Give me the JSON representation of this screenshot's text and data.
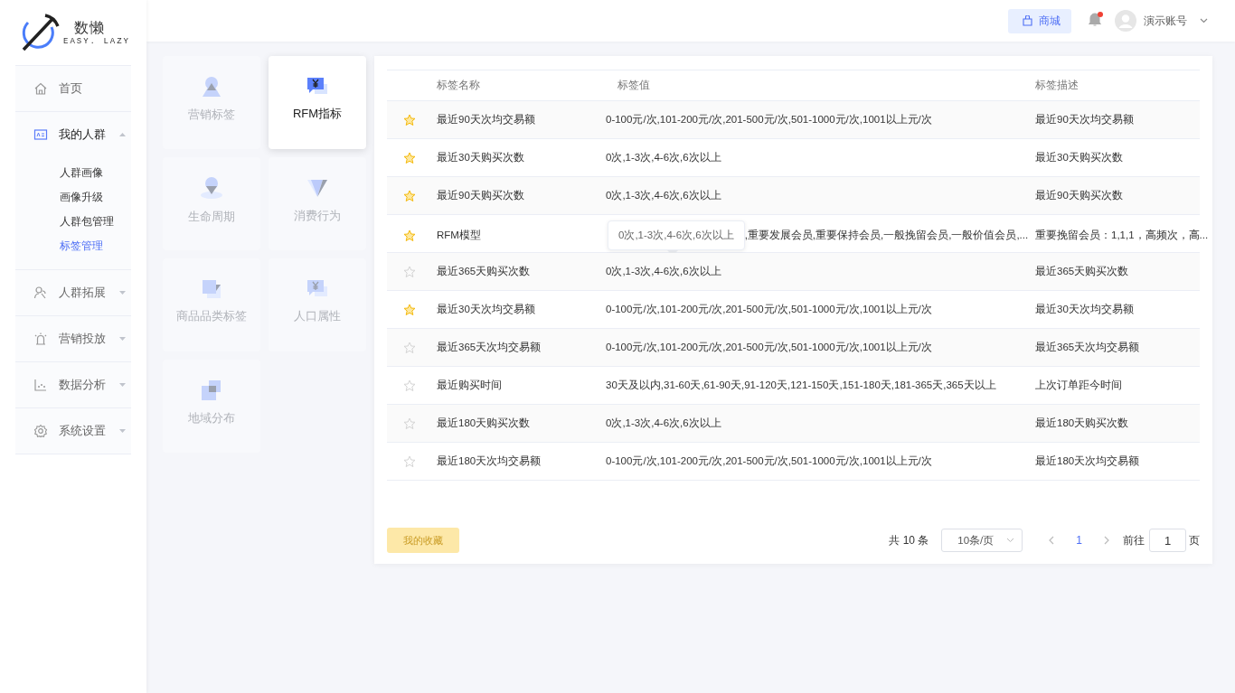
{
  "logo": {
    "name": "数懒",
    "tagline": "EASY. LAZY"
  },
  "sidebar": {
    "items": [
      {
        "kind": "link",
        "label": "首页"
      },
      {
        "kind": "group",
        "label": "我的人群",
        "expanded": true,
        "children": [
          {
            "label": "人群画像",
            "selected": false
          },
          {
            "label": "画像升级",
            "selected": false
          },
          {
            "label": "人群包管理",
            "selected": false
          },
          {
            "label": "标签管理",
            "selected": true
          }
        ]
      },
      {
        "kind": "group",
        "label": "人群拓展",
        "expanded": false
      },
      {
        "kind": "group",
        "label": "营销投放",
        "expanded": false
      },
      {
        "kind": "group",
        "label": "数据分析",
        "expanded": false
      },
      {
        "kind": "group",
        "label": "系统设置",
        "expanded": false
      }
    ]
  },
  "topbar": {
    "shop_button": "商城",
    "unread_notifications": true,
    "account": "演示账号"
  },
  "categories": [
    {
      "label": "营销标签",
      "selected": false
    },
    {
      "label": "RFM指标",
      "selected": true
    },
    {
      "label": "生命周期",
      "selected": false
    },
    {
      "label": "消费行为",
      "selected": false
    },
    {
      "label": "商品品类标签",
      "selected": false
    },
    {
      "label": "人口属性",
      "selected": false
    },
    {
      "label": "地域分布",
      "selected": false
    }
  ],
  "table": {
    "columns": [
      "标签名称",
      "标签值",
      "标签描述"
    ],
    "rows": [
      {
        "favorite": true,
        "name": "最近90天次均交易额",
        "value": "0-100元/次,101-200元/次,201-500元/次,501-1000元/次,1001以上元/次",
        "description": "最近90天次均交易额"
      },
      {
        "favorite": true,
        "name": "最近30天购买次数",
        "value": "0次,1-3次,4-6次,6次以上",
        "description": "最近30天购买次数"
      },
      {
        "favorite": true,
        "name": "最近90天购买次数",
        "value": "0次,1-3次,4-6次,6次以上",
        "description": "最近90天购买次数"
      },
      {
        "favorite": true,
        "name": "RFM模型",
        "tooltip": "0次,1-3次,4-6次,6次以上",
        "value": ",重要发展会员,重要保持会员,一般挽留会员,一般价值会员,...",
        "description": "重要挽留会员：1,1,1，高频次，高..."
      },
      {
        "favorite": false,
        "name": "最近365天购买次数",
        "value": "0次,1-3次,4-6次,6次以上",
        "description": "最近365天购买次数"
      },
      {
        "favorite": true,
        "name": "最近30天次均交易额",
        "value": "0-100元/次,101-200元/次,201-500元/次,501-1000元/次,1001以上元/次",
        "description": "最近30天次均交易额"
      },
      {
        "favorite": false,
        "name": "最近365天次均交易额",
        "value": "0-100元/次,101-200元/次,201-500元/次,501-1000元/次,1001以上元/次",
        "description": "最近365天次均交易额"
      },
      {
        "favorite": false,
        "name": "最近购买时间",
        "value": "30天及以内,31-60天,61-90天,91-120天,121-150天,151-180天,181-365天,365天以上",
        "description": "上次订单距今时间"
      },
      {
        "favorite": false,
        "name": "最近180天购买次数",
        "value": "0次,1-3次,4-6次,6次以上",
        "description": "最近180天购买次数"
      },
      {
        "favorite": false,
        "name": "最近180天次均交易额",
        "value": "0-100元/次,101-200元/次,201-500元/次,501-1000元/次,1001以上元/次",
        "description": "最近180天次均交易额"
      }
    ]
  },
  "footer": {
    "favorites_button": "我的收藏",
    "pagination": {
      "total": "共 10 条",
      "page_size": "10条/页",
      "pages": [
        {
          "label": "1",
          "selected": true
        }
      ],
      "jump_label": "前往",
      "jump_value": "1",
      "page_unit": "页"
    }
  }
}
